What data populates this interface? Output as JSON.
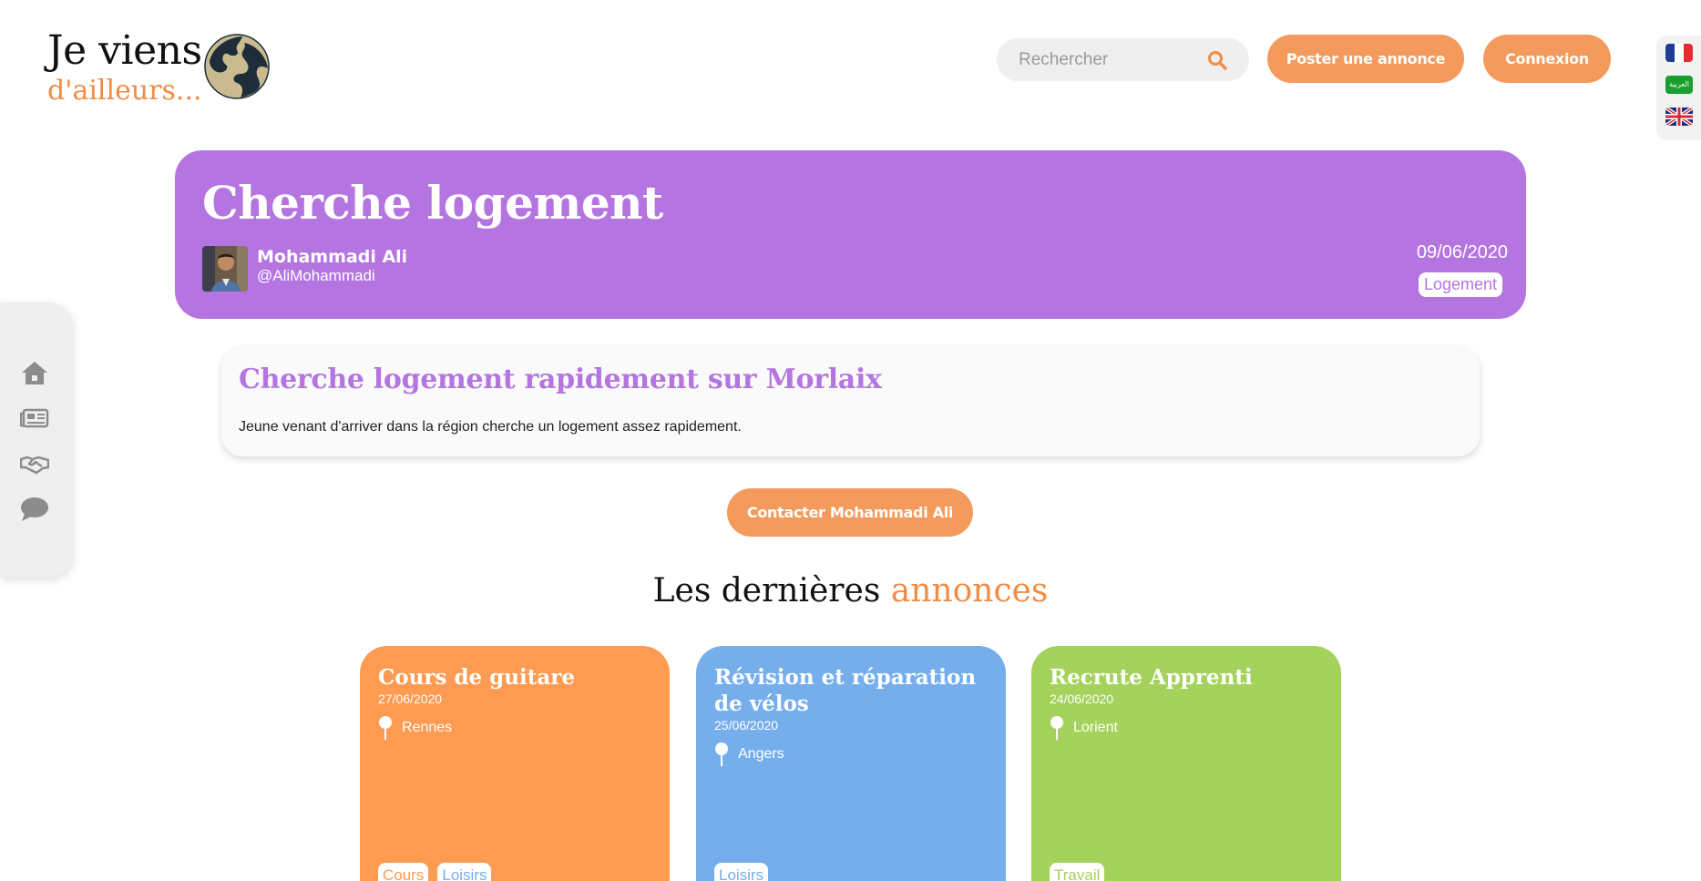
{
  "header": {
    "logo_line1": "Je viens",
    "logo_line2": "d'ailleurs...",
    "logo_icon": "globe-icon",
    "search_placeholder": "Rechercher",
    "search_icon": "search-icon",
    "post_button": "Poster une annonce",
    "login_button": "Connexion"
  },
  "languages": [
    {
      "name": "Français",
      "icon": "flag-fr-icon"
    },
    {
      "name": "العربية",
      "icon": "flag-ar-icon"
    },
    {
      "name": "English",
      "icon": "flag-en-icon"
    }
  ],
  "side_nav": [
    {
      "icon": "home-icon"
    },
    {
      "icon": "newspaper-icon"
    },
    {
      "icon": "handshake-icon"
    },
    {
      "icon": "chat-bubble-icon"
    }
  ],
  "listing": {
    "title": "Cherche logement",
    "author_name": "Mohammadi Ali",
    "author_handle": "@AliMohammadi",
    "date": "09/06/2020",
    "tag": "Logement",
    "subtitle": "Cherche logement rapidement sur Morlaix",
    "description": "Jeune venant d'arriver dans la région cherche un logement assez rapidement.",
    "contact_button": "Contacter Mohammadi Ali"
  },
  "latest": {
    "title_part1": "Les dernières",
    "title_part2": "annonces",
    "cards": [
      {
        "title": "Cours de guitare",
        "date": "27/06/2020",
        "location": "Rennes",
        "tags": [
          "Cours",
          "Loisirs"
        ],
        "color": "#fd9b52"
      },
      {
        "title": "Révision et réparation de vélos",
        "date": "25/06/2020",
        "location": "Angers",
        "tags": [
          "Loisirs"
        ],
        "color": "#76aeec"
      },
      {
        "title": "Recrute Apprenti",
        "date": "24/06/2020",
        "location": "Lorient",
        "tags": [
          "Travail"
        ],
        "color": "#a4d25c"
      }
    ]
  },
  "colors": {
    "accent_orange": "#f39a5c",
    "banner_purple": "#b475e1",
    "tag_cours": "#fd9b52",
    "tag_loisirs": "#76aeec",
    "tag_travail": "#a4d25c"
  }
}
